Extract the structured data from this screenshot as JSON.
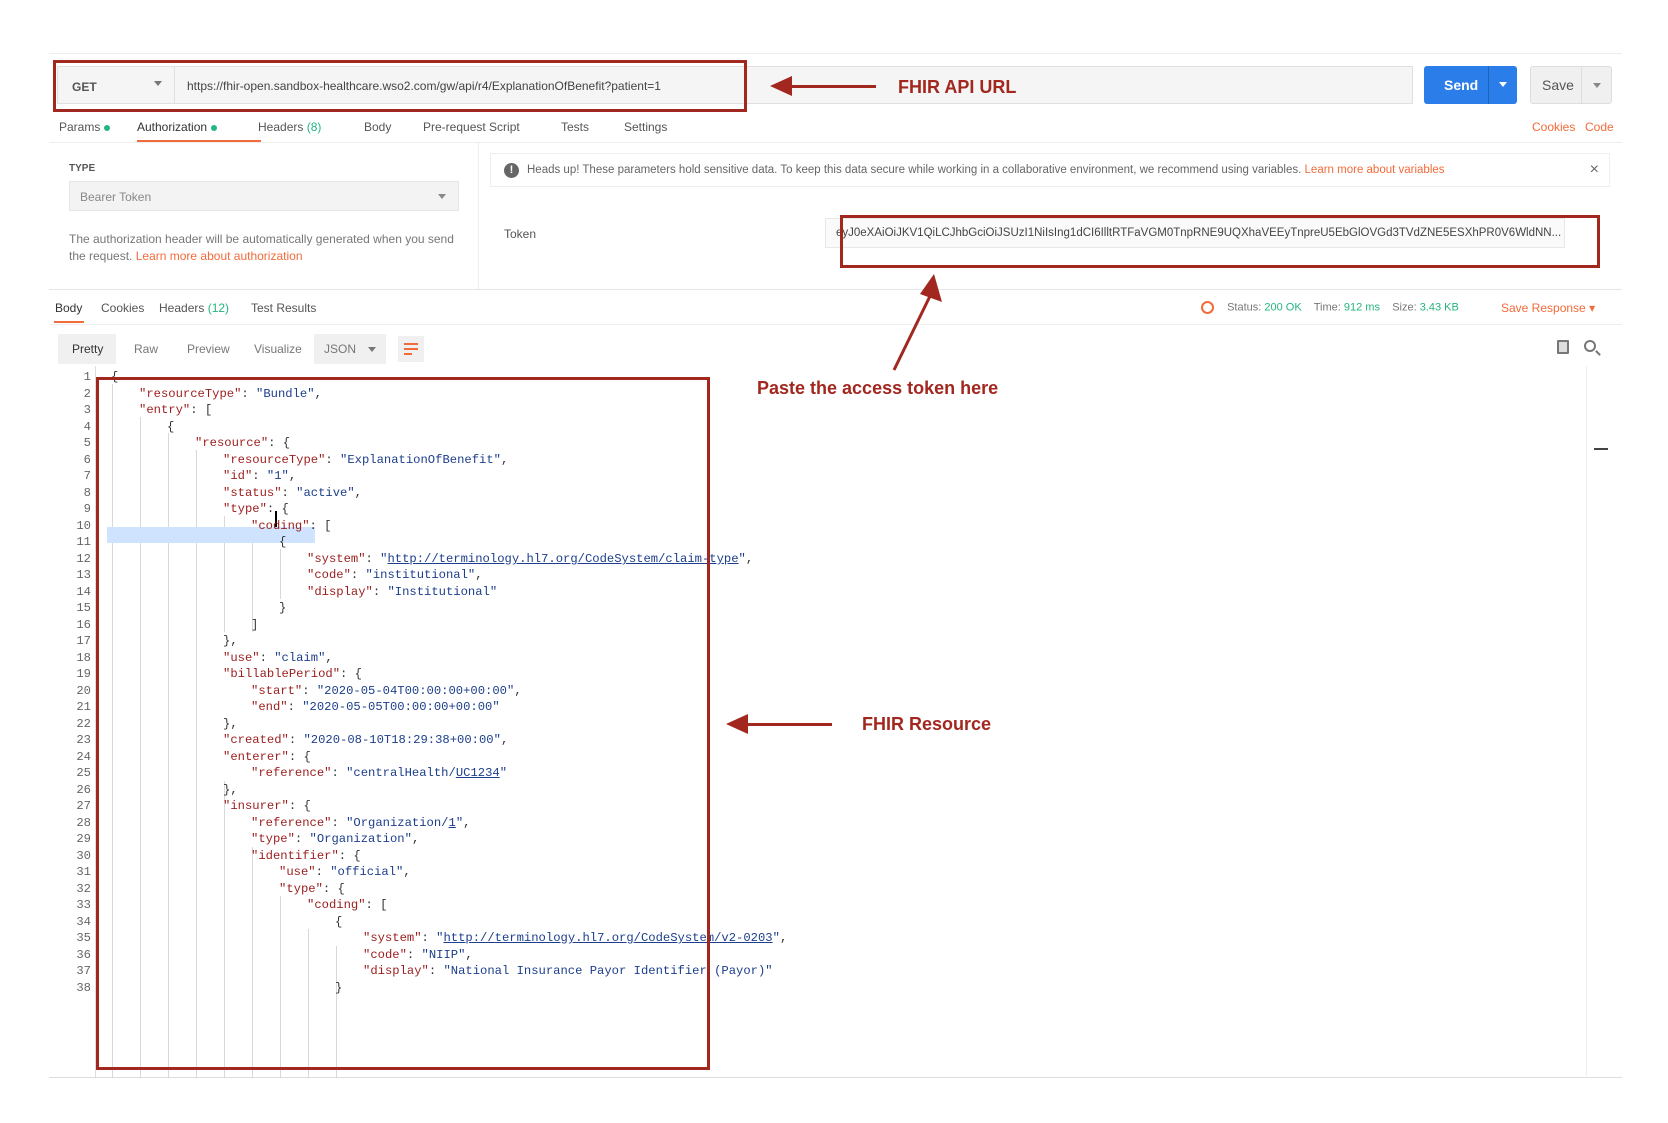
{
  "request": {
    "method": "GET",
    "url": "https://fhir-open.sandbox-healthcare.wso2.com/gw/api/r4/ExplanationOfBenefit?patient=1",
    "send_label": "Send",
    "save_label": "Save"
  },
  "request_tabs": {
    "params": "Params",
    "authorization": "Authorization",
    "headers": "Headers",
    "headers_count": "(8)",
    "body": "Body",
    "prerequest": "Pre-request Script",
    "tests": "Tests",
    "settings": "Settings",
    "cookies_link": "Cookies",
    "code_link": "Code"
  },
  "auth": {
    "type_label": "TYPE",
    "type_value": "Bearer Token",
    "description": "The authorization header will be automatically generated when you send the request.",
    "description_link": "Learn more about authorization",
    "headsup_text": "Heads up! These parameters hold sensitive data. To keep this data secure while working in a collaborative environment, we recommend using variables.",
    "headsup_link": "Learn more about variables",
    "token_label": "Token",
    "token_value": "eyJ0eXAiOiJKV1QiLCJhbGciOiJSUzI1NiIsIng1dCI6IlltRTFaVGM0TnpRNE9UQXhaVEEyTnpreU5EbGlOVGd3TVdZNE5ESXhPR0V6WldNN..."
  },
  "response_tabs": {
    "body": "Body",
    "cookies": "Cookies",
    "headers": "Headers",
    "headers_count": "(12)",
    "test_results": "Test Results",
    "status_label": "Status:",
    "status_value": "200 OK",
    "time_label": "Time:",
    "time_value": "912 ms",
    "size_label": "Size:",
    "size_value": "3.43 KB",
    "save_response": "Save Response"
  },
  "view": {
    "pretty": "Pretty",
    "raw": "Raw",
    "preview": "Preview",
    "visualize": "Visualize",
    "format": "JSON"
  },
  "code_lines": [
    "1",
    "2",
    "3",
    "4",
    "5",
    "6",
    "7",
    "8",
    "9",
    "10",
    "11",
    "12",
    "13",
    "14",
    "15",
    "16",
    "17",
    "18",
    "19",
    "20",
    "21",
    "22",
    "23",
    "24",
    "25",
    "26",
    "27",
    "28",
    "29",
    "30",
    "31",
    "32",
    "33",
    "34",
    "35",
    "36",
    "37",
    "38"
  ],
  "annotations": {
    "url": "FHIR API URL",
    "token": "Paste the access token here",
    "resource": "FHIR Resource"
  },
  "colors": {
    "annotation_red": "#a1271f",
    "accent_orange": "#f26b3a",
    "send_blue": "#2b7de9",
    "status_green": "#26b47f"
  }
}
